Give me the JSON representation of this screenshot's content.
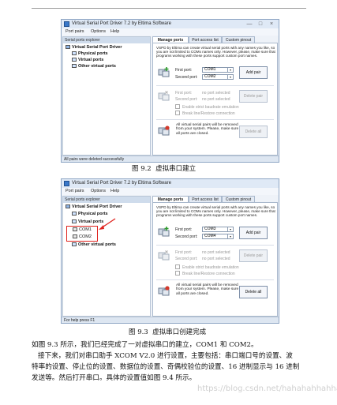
{
  "window": {
    "title": "Virtual Serial Port Driver 7.2 by Eltima Software",
    "controls": {
      "minimize": "—",
      "maximize": "□",
      "close": "×"
    },
    "menu": [
      "Port pairs",
      "Options",
      "Help"
    ],
    "tree_header": "Serial ports explorer",
    "tabs": [
      "Manage ports",
      "Port access list",
      "Custom pinout"
    ],
    "description": "VSPD by Eltima can create virtual serial ports with any names you like, so you are not limited to COMx names only. However, please, make sure that programs working with these ports support custom port names.",
    "first_port_label": "First port:",
    "second_port_label": "Second port:",
    "add_pair": "Add pair",
    "no_port_selected": "no port selected",
    "delete_pair": "Delete pair",
    "enable_strict": "Enable strict baudrate emulation",
    "break_line": "Break line/Restore connection",
    "remove_info": "All virtual serial pairs will be removed from your system. Please, make sure all ports are closed.",
    "delete_all": "Delete all"
  },
  "figure1": {
    "tree": [
      "Virtual Serial Port Driver",
      "Physical ports",
      "Virtual ports",
      "Other virtual ports"
    ],
    "first_port": "COM1",
    "second_port": "COM2",
    "status": "All pairs were deleted successfully",
    "caption_num": "图 9.2",
    "caption_text": "虚拟串口建立"
  },
  "figure2": {
    "tree": [
      "Virtual Serial Port Driver",
      "Physical ports",
      "Virtual ports",
      "COM1",
      "COM2",
      "Other virtual ports"
    ],
    "first_port": "COM3",
    "second_port": "COM4",
    "status": "For help press F1",
    "caption_num": "图 9.3",
    "caption_text": "虚拟串口创建完成"
  },
  "paragraph": {
    "line1": "如图 9.3 所示，我们已经完成了一对虚拟串口的建立，COM1 和 COM2。",
    "line2": "接下来，我们对串口助手 XCOM V2.0 进行设置，主要包括：串口端口号的设置、波",
    "line3": "特率的设置、停止位的设置、数据位的设置、奇偶校验位的设置、16 进制显示与 16 进制",
    "line4": "发送等。然后打开串口。具体的设置值如图 9.4 所示。"
  },
  "watermark": "https://blog.csdn.net/hahahahhahha",
  "colors": {
    "highlight": "#e0231e",
    "accent": "#3a78c9"
  }
}
